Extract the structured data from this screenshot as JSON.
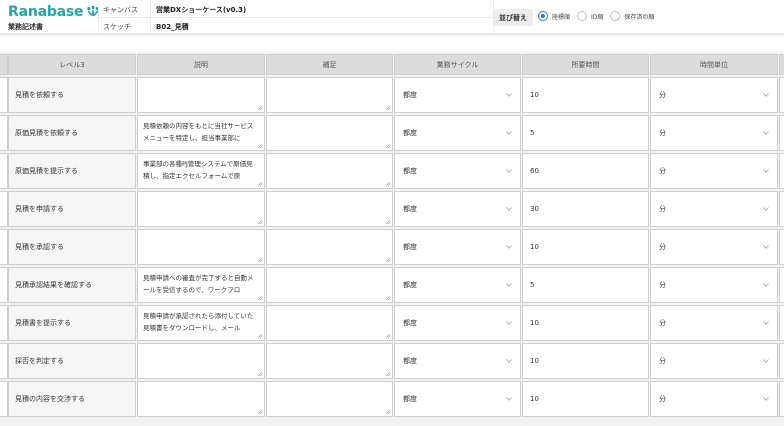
{
  "header": {
    "logo_text": "Ranabase",
    "app_subtitle": "業務記述書",
    "canvas_label": "キャンバス",
    "canvas_value": "営業DXショーケース(v0.3)",
    "sketch_label": "スケッチ",
    "sketch_value": "B02_見積",
    "sort_label": "並び替え",
    "sort_options": [
      {
        "label": "座標順",
        "selected": true
      },
      {
        "label": "ID順",
        "selected": false
      },
      {
        "label": "保存済の順",
        "selected": false
      }
    ],
    "accent_color": "#2aa3a8",
    "radio_color": "#1f77e0"
  },
  "table": {
    "columns": [
      "レベル3",
      "説明",
      "補足",
      "業務サイクル",
      "所要時間",
      "時間単位"
    ],
    "rows": [
      {
        "level3": "見積を依頼する",
        "description": "",
        "note": "",
        "cycle": "都度",
        "duration": "10",
        "unit": "分"
      },
      {
        "level3": "原価見積を依頼する",
        "description": "見積依頼の内容をもとに当社サービスメニューを特定し、担当事業部に",
        "note": "",
        "cycle": "都度",
        "duration": "5",
        "unit": "分"
      },
      {
        "level3": "原価見積を提示する",
        "description": "事業部の各種PJ管理システムで原価見積し、指定エクセルフォームで原",
        "note": "",
        "cycle": "都度",
        "duration": "60",
        "unit": "分"
      },
      {
        "level3": "見積を申請する",
        "description": "",
        "note": "",
        "cycle": "都度",
        "duration": "30",
        "unit": "分"
      },
      {
        "level3": "見積を承認する",
        "description": "",
        "note": "",
        "cycle": "都度",
        "duration": "10",
        "unit": "分"
      },
      {
        "level3": "見積承認結果を確認する",
        "description": "見積申請への審査が完了すると自動メールを受信するので、ワークフロ",
        "note": "",
        "cycle": "都度",
        "duration": "5",
        "unit": "分"
      },
      {
        "level3": "見積書を提示する",
        "description": "見積申請が承認されたら添付していた見積書をダウンロードし、メール",
        "note": "",
        "cycle": "都度",
        "duration": "10",
        "unit": "分"
      },
      {
        "level3": "採否を判定する",
        "description": "",
        "note": "",
        "cycle": "都度",
        "duration": "10",
        "unit": "分"
      },
      {
        "level3": "見積の内容を交渉する",
        "description": "",
        "note": "",
        "cycle": "都度",
        "duration": "10",
        "unit": "分"
      }
    ]
  }
}
